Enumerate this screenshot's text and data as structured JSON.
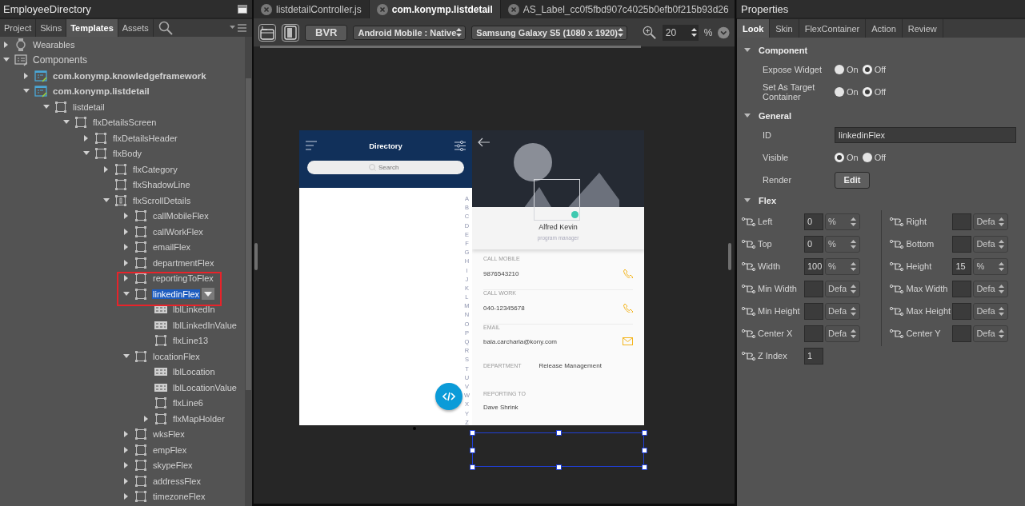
{
  "left_panel": {
    "title": "EmployeeDirectory",
    "tabs": [
      {
        "label": "Project",
        "selected": false
      },
      {
        "label": "Skins",
        "selected": false
      },
      {
        "label": "Templates",
        "selected": true
      },
      {
        "label": "Assets",
        "selected": false
      }
    ],
    "tree": [
      {
        "label": "Wearables",
        "kind": "device",
        "expanded": false,
        "selected": false,
        "annotated": false
      },
      {
        "label": "Components",
        "kind": "group",
        "expanded": true,
        "selected": false,
        "annotated": false,
        "children": [
          {
            "label": "com.konymp.knowledgeframework",
            "kind": "component",
            "expanded": false,
            "selected": false,
            "annotated": false
          },
          {
            "label": "com.konymp.listdetail",
            "kind": "component",
            "expanded": true,
            "selected": false,
            "annotated": false,
            "children": [
              {
                "label": "listdetail",
                "kind": "flex",
                "expanded": true,
                "selected": false,
                "annotated": false,
                "children": [
                  {
                    "label": "flxDetailsScreen",
                    "kind": "flex",
                    "expanded": true,
                    "selected": false,
                    "annotated": false,
                    "children": [
                      {
                        "label": "flxDetailsHeader",
                        "kind": "flex",
                        "expanded": false,
                        "selected": false,
                        "annotated": false
                      },
                      {
                        "label": "flxBody",
                        "kind": "flex",
                        "expanded": true,
                        "selected": false,
                        "annotated": false,
                        "children": [
                          {
                            "label": "flxCategory",
                            "kind": "flex",
                            "expanded": false,
                            "selected": false,
                            "annotated": false
                          },
                          {
                            "label": "flxShadowLine",
                            "kind": "flex",
                            "selected": false,
                            "annotated": false
                          },
                          {
                            "label": "flxScrollDetails",
                            "kind": "scroll",
                            "expanded": true,
                            "selected": false,
                            "annotated": false,
                            "children": [
                              {
                                "label": "callMobileFlex",
                                "kind": "flex",
                                "expanded": false,
                                "selected": false,
                                "annotated": false
                              },
                              {
                                "label": "callWorkFlex",
                                "kind": "flex",
                                "expanded": false,
                                "selected": false,
                                "annotated": false
                              },
                              {
                                "label": "emailFlex",
                                "kind": "flex",
                                "expanded": false,
                                "selected": false,
                                "annotated": false
                              },
                              {
                                "label": "departmentFlex",
                                "kind": "flex",
                                "expanded": false,
                                "selected": false,
                                "annotated": false
                              },
                              {
                                "label": "reportingToFlex",
                                "kind": "flex",
                                "expanded": false,
                                "selected": false,
                                "annotated": true
                              },
                              {
                                "label": "linkedinFlex",
                                "kind": "flex",
                                "expanded": true,
                                "selected": true,
                                "annotated": true,
                                "children": [
                                  {
                                    "label": "lblLinkedIn",
                                    "kind": "label",
                                    "selected": false,
                                    "annotated": false
                                  },
                                  {
                                    "label": "lblLinkedInValue",
                                    "kind": "label",
                                    "selected": false,
                                    "annotated": false
                                  },
                                  {
                                    "label": "flxLine13",
                                    "kind": "flex",
                                    "selected": false,
                                    "annotated": false
                                  }
                                ]
                              },
                              {
                                "label": "locationFlex",
                                "kind": "flex",
                                "expanded": true,
                                "selected": false,
                                "annotated": false,
                                "children": [
                                  {
                                    "label": "lblLocation",
                                    "kind": "label",
                                    "selected": false,
                                    "annotated": false
                                  },
                                  {
                                    "label": "lblLocationValue",
                                    "kind": "label",
                                    "selected": false,
                                    "annotated": false
                                  },
                                  {
                                    "label": "flxLine6",
                                    "kind": "flex",
                                    "selected": false,
                                    "annotated": false
                                  },
                                  {
                                    "label": "flxMapHolder",
                                    "kind": "flex",
                                    "expanded": false,
                                    "selected": false,
                                    "annotated": false
                                  }
                                ]
                              },
                              {
                                "label": "wksFlex",
                                "kind": "flex",
                                "expanded": false,
                                "selected": false,
                                "annotated": false
                              },
                              {
                                "label": "empFlex",
                                "kind": "flex",
                                "expanded": false,
                                "selected": false,
                                "annotated": false
                              },
                              {
                                "label": "skypeFlex",
                                "kind": "flex",
                                "expanded": false,
                                "selected": false,
                                "annotated": false
                              },
                              {
                                "label": "addressFlex",
                                "kind": "flex",
                                "expanded": false,
                                "selected": false,
                                "annotated": false
                              },
                              {
                                "label": "timezoneFlex",
                                "kind": "flex",
                                "expanded": false,
                                "selected": false,
                                "annotated": false
                              }
                            ]
                          }
                        ]
                      }
                    ]
                  }
                ]
              }
            ]
          }
        ]
      }
    ]
  },
  "editor": {
    "tabs": [
      {
        "label": "listdetailController.js",
        "selected": false
      },
      {
        "label": "com.konymp.listdetail",
        "selected": true
      },
      {
        "label": "AS_Label_cc0f5fbd907c4025b0efb0f215b93d26",
        "selected": false
      }
    ],
    "toolbar": {
      "mode_button": "BVR",
      "platform": "Android Mobile : Native",
      "device": "Samsung Galaxy S5 (1080 x 1920)",
      "zoom": "20",
      "zoom_unit": "%"
    },
    "preview": {
      "list": {
        "title": "Directory",
        "search_placeholder": "Search",
        "index_letters": [
          "A",
          "B",
          "C",
          "D",
          "E",
          "F",
          "G",
          "H",
          "I",
          "J",
          "K",
          "L",
          "M",
          "N",
          "O",
          "P",
          "Q",
          "R",
          "S",
          "T",
          "U",
          "V",
          "W",
          "X",
          "Y",
          "Z"
        ]
      },
      "detail": {
        "name": "Alfred Kevin",
        "role": "program manager",
        "fields": [
          {
            "label": "CALL MOBILE",
            "value": "9876543210",
            "kind": "phone"
          },
          {
            "label": "CALL WORK",
            "value": "040-12345678",
            "kind": "phone"
          },
          {
            "label": "EMAIL",
            "value": "bala.carcharla@kony.com",
            "kind": "email"
          },
          {
            "label": "DEPARTMENT",
            "value": "Release Management",
            "kind": "inline"
          },
          {
            "label": "REPORTING TO",
            "value": "Dave Shrink",
            "kind": "plain"
          }
        ]
      }
    }
  },
  "properties": {
    "title": "Properties",
    "tabs": [
      {
        "label": "Look",
        "selected": true
      },
      {
        "label": "Skin",
        "selected": false
      },
      {
        "label": "FlexContainer",
        "selected": false
      },
      {
        "label": "Action",
        "selected": false
      },
      {
        "label": "Review",
        "selected": false
      }
    ],
    "sections": [
      {
        "title": "Component",
        "expanded": true,
        "rows": [
          {
            "kind": "radio",
            "label": "Expose Widget",
            "options": [
              {
                "label": "On",
                "selected": false
              },
              {
                "label": "Off",
                "selected": true
              }
            ]
          },
          {
            "kind": "radio",
            "label": "Set As Target Container",
            "options": [
              {
                "label": "On",
                "selected": false
              },
              {
                "label": "Off",
                "selected": true
              }
            ]
          }
        ]
      },
      {
        "title": "General",
        "expanded": true,
        "rows": [
          {
            "kind": "text",
            "label": "ID",
            "value": "linkedinFlex"
          },
          {
            "kind": "radio",
            "label": "Visible",
            "options": [
              {
                "label": "On",
                "selected": true
              },
              {
                "label": "Off",
                "selected": false
              }
            ]
          },
          {
            "kind": "button",
            "label": "Render",
            "button": "Edit"
          }
        ]
      }
    ],
    "flex": {
      "title": "Flex",
      "expanded": true,
      "left": [
        {
          "label": "Left",
          "value": "0",
          "unit": "%"
        },
        {
          "label": "Top",
          "value": "0",
          "unit": "%"
        },
        {
          "label": "Width",
          "value": "100",
          "unit": "%"
        },
        {
          "label": "Min Width",
          "unit": "Defa"
        },
        {
          "label": "Min Height",
          "unit": "Defa"
        },
        {
          "label": "Center X",
          "unit": "Defa"
        },
        {
          "label": "Z Index",
          "value": "1"
        }
      ],
      "right": [
        {
          "label": "Right",
          "unit": "Defa"
        },
        {
          "label": "Bottom",
          "unit": "Defa"
        },
        {
          "label": "Height",
          "value": "15",
          "unit": "%"
        },
        {
          "label": "Max Width",
          "unit": "Defa"
        },
        {
          "label": "Max Height",
          "unit": "Defa"
        },
        {
          "label": "Center Y",
          "unit": "Defa"
        }
      ]
    }
  }
}
